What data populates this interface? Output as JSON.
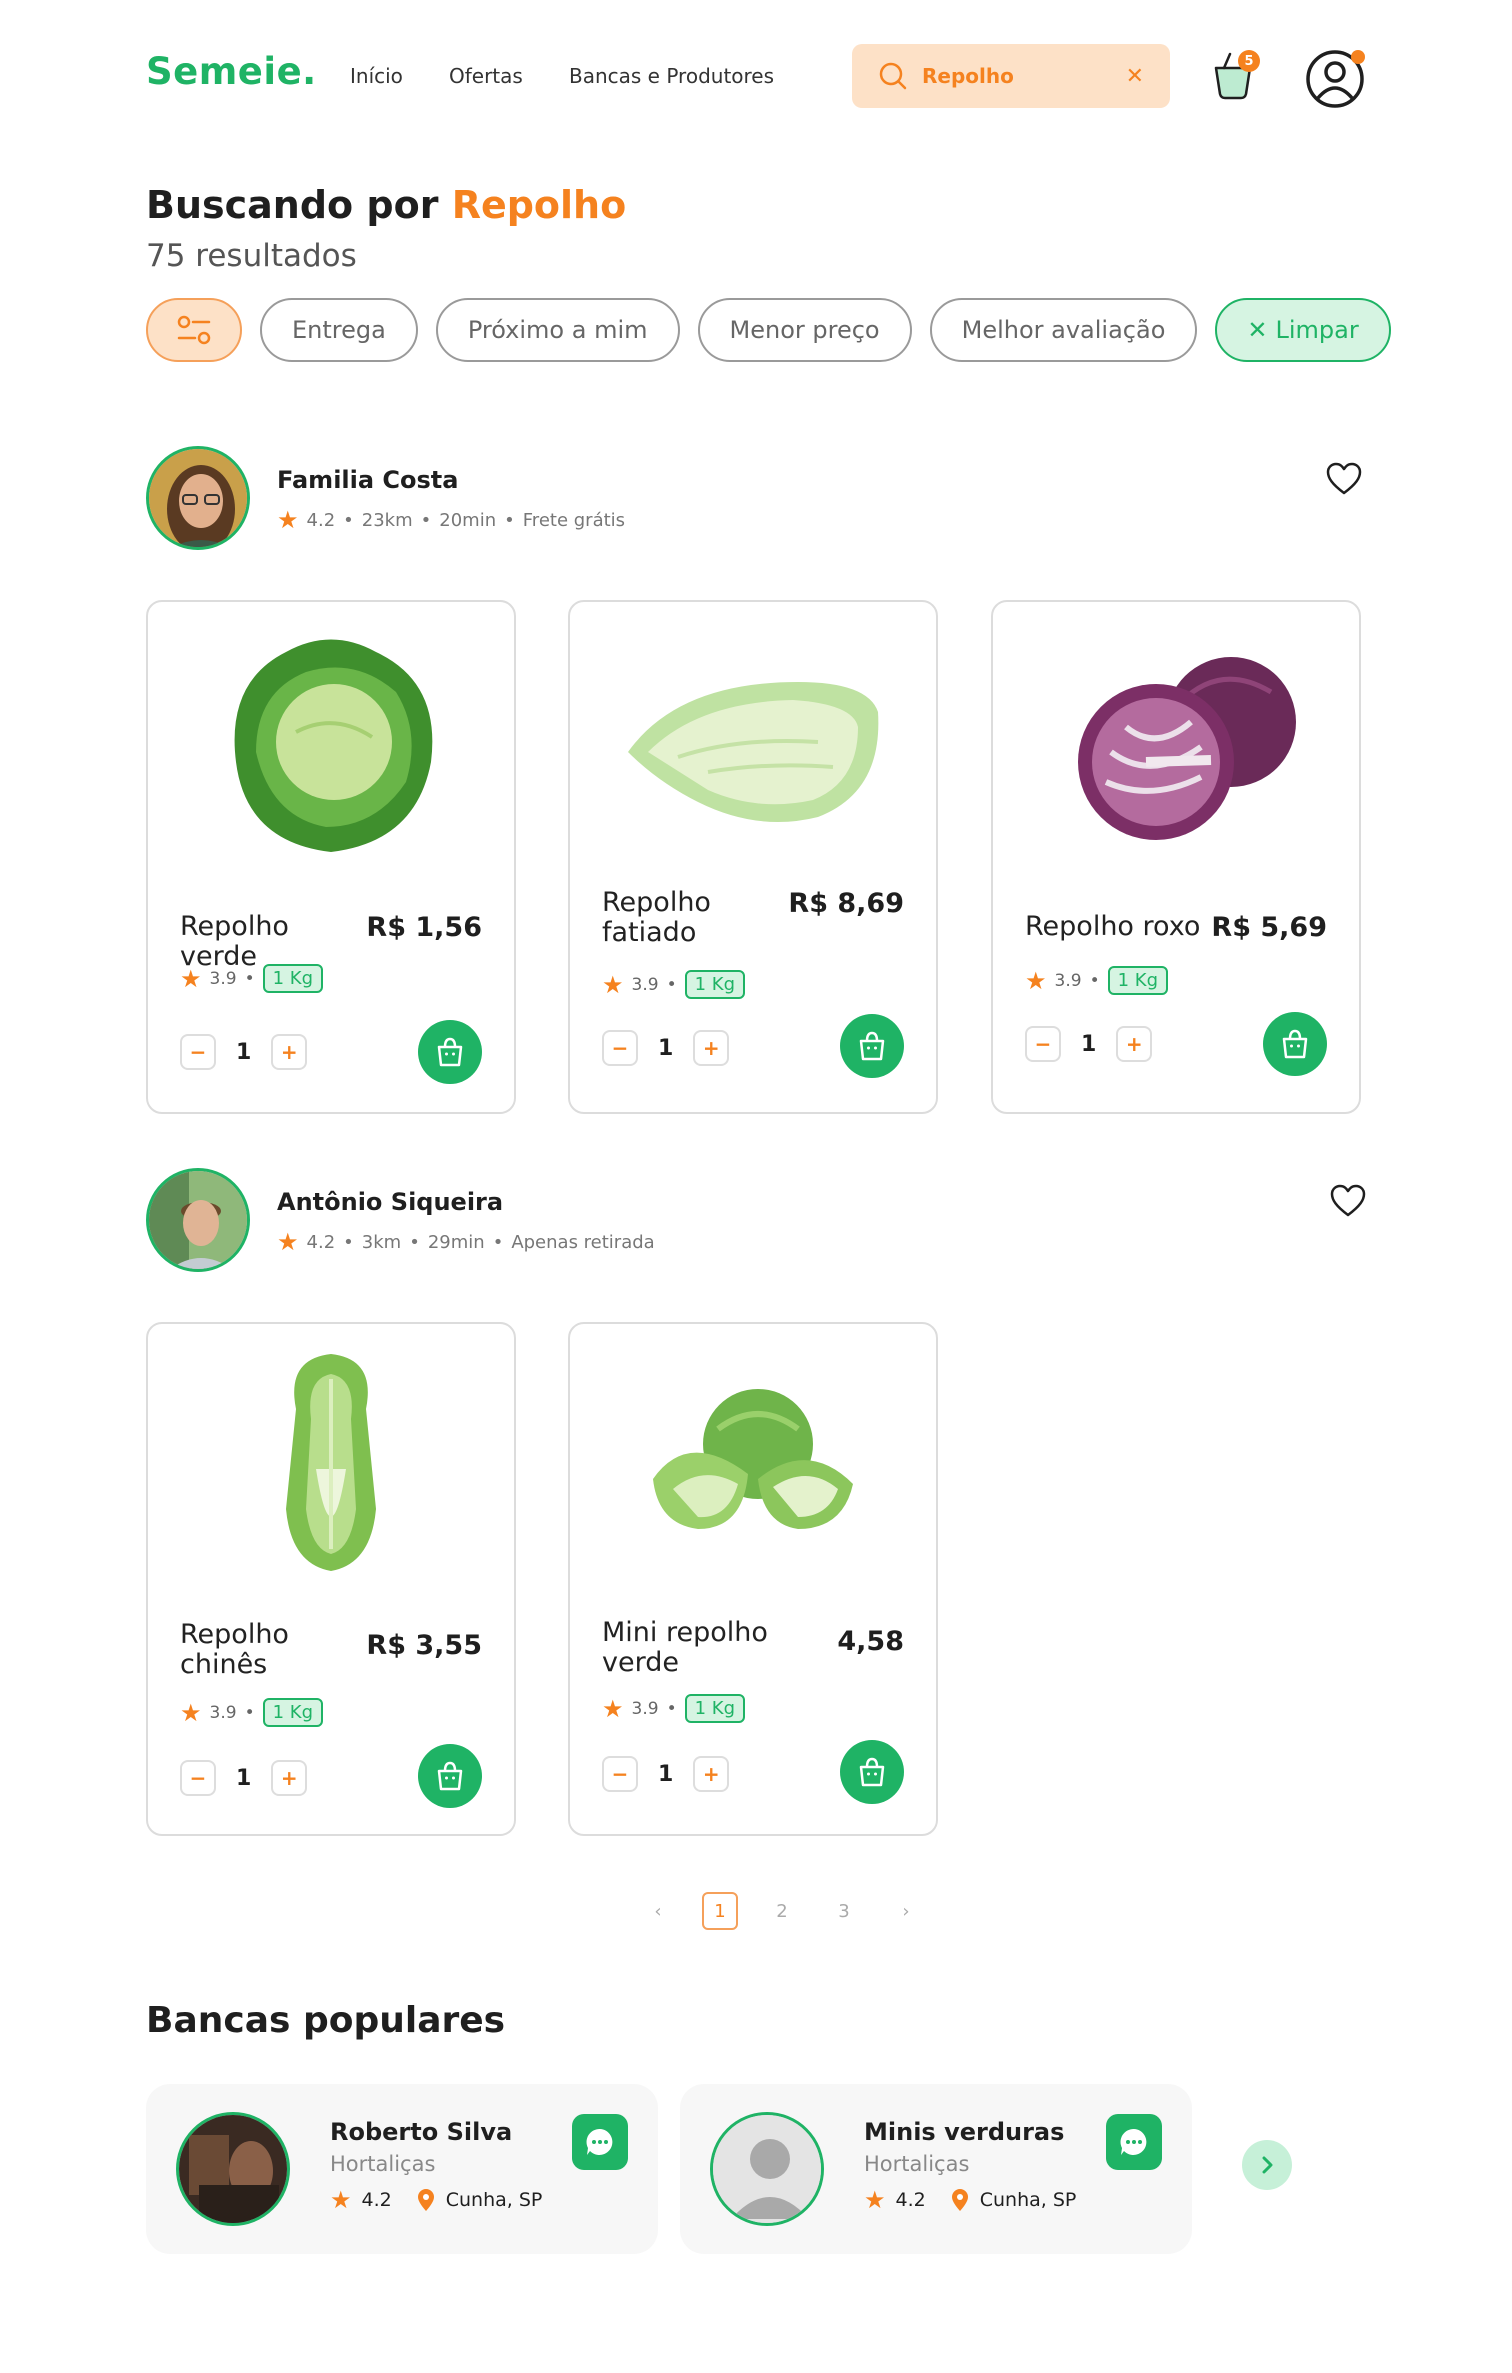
{
  "header": {
    "logo": "Semeie.",
    "nav": [
      "Início",
      "Ofertas",
      "Bancas e Produtores"
    ],
    "search_value": "Repolho",
    "cart_count": "5"
  },
  "search": {
    "title_prefix": "Buscando por",
    "query": "Repolho",
    "results": "75 resultados",
    "chips": [
      "Entrega",
      "Próximo a mim",
      "Menor preço",
      "Melhor avaliação"
    ],
    "clear": "Limpar"
  },
  "stores": [
    {
      "name": "Familia  Costa",
      "rating": "4.2",
      "distance": "23km",
      "time": "20min",
      "delivery": "Frete grátis",
      "products": [
        {
          "name": "Repolho verde",
          "price": "R$ 1,56",
          "rating": "3.9",
          "unit": "1 Kg",
          "qty": "1"
        },
        {
          "name": "Repolho fatiado",
          "price": "R$ 8,69",
          "rating": "3.9",
          "unit": "1 Kg",
          "qty": "1"
        },
        {
          "name": "Repolho roxo",
          "price": "R$ 5,69",
          "rating": "3.9",
          "unit": "1 Kg",
          "qty": "1"
        }
      ]
    },
    {
      "name": "Antônio Siqueira",
      "rating": "4.2",
      "distance": "3km",
      "time": "29min",
      "delivery": "Apenas retirada",
      "products": [
        {
          "name": "Repolho chinês",
          "price": "R$ 3,55",
          "rating": "3.9",
          "unit": "1 Kg",
          "qty": "1"
        },
        {
          "name": "Mini repolho verde",
          "price": "4,58",
          "rating": "3.9",
          "unit": "1 Kg",
          "qty": "1"
        }
      ]
    }
  ],
  "pagination": {
    "pages": [
      "1",
      "2",
      "3"
    ],
    "current": "1"
  },
  "popular": {
    "title": "Bancas populares",
    "items": [
      {
        "name": "Roberto Silva",
        "category": "Hortaliças",
        "rating": "4.2",
        "location": "Cunha, SP"
      },
      {
        "name": "Minis verduras",
        "category": "Hortaliças",
        "rating": "4.2",
        "location": "Cunha, SP"
      }
    ]
  },
  "colors": {
    "green": "#1fb365",
    "orange": "#f5821f",
    "peach": "#fde1c7"
  },
  "icons": [
    "search-icon",
    "close-icon",
    "cart-icon",
    "user-icon",
    "filter-icon",
    "star-icon",
    "heart-icon",
    "bag-icon",
    "chat-icon",
    "location-icon",
    "chevron-left-icon",
    "chevron-right-icon"
  ]
}
